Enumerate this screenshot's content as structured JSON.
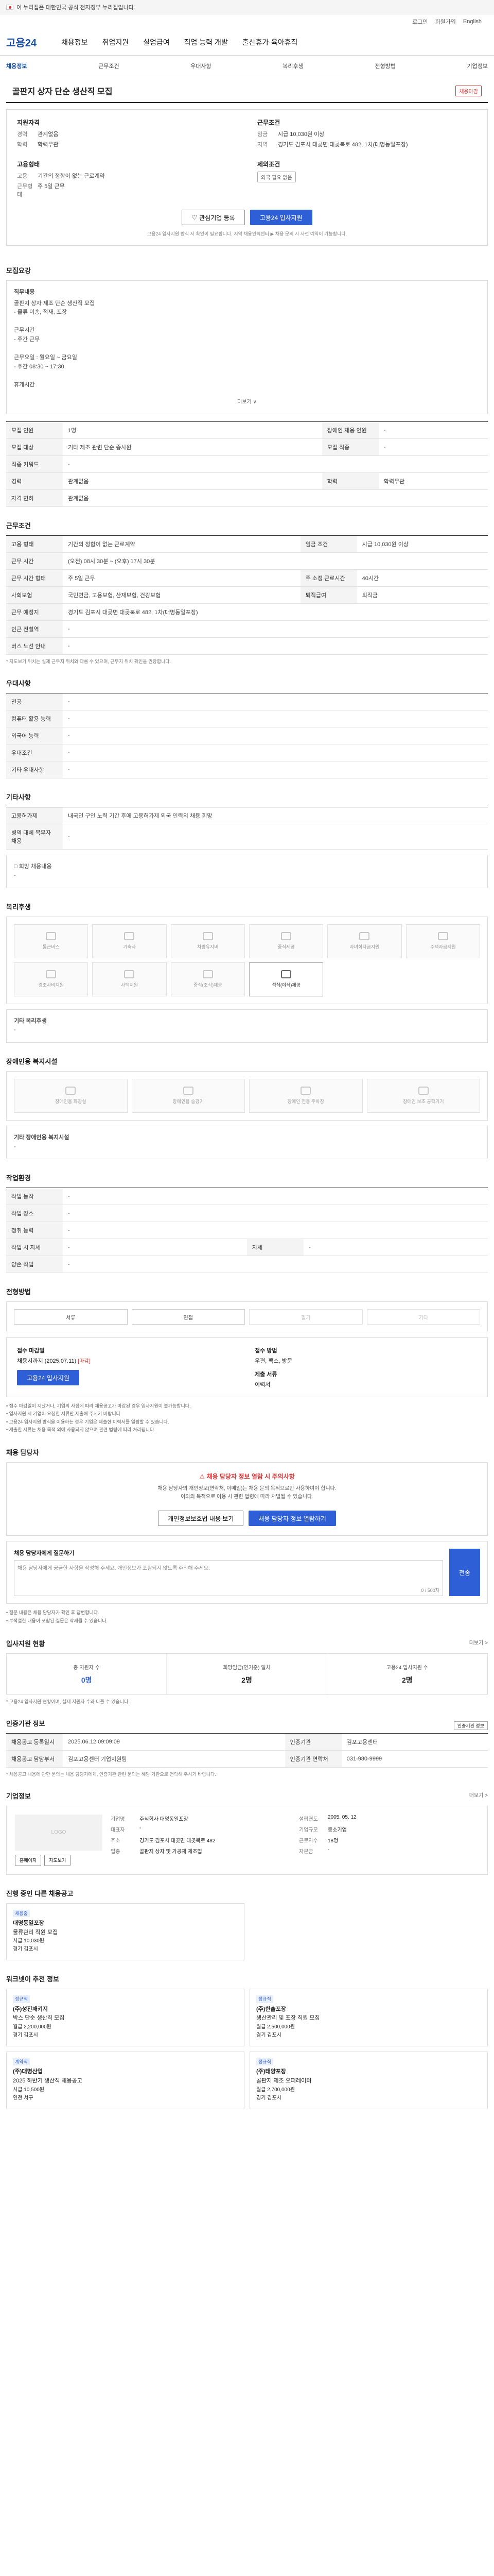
{
  "gov_banner": "이 누리집은 대한민국 공식 전자정부 누리집입니다.",
  "util": [
    "로그인",
    "회원가입",
    "English"
  ],
  "logo": "고용24",
  "gnb": [
    "채용정보",
    "취업지원",
    "실업급여",
    "직업 능력 개발",
    "출산휴가·육아휴직"
  ],
  "subnav": [
    "채용정보",
    "근무조건",
    "우대사항",
    "복리후생",
    "전형방법",
    "기업정보"
  ],
  "title": "골판지 상자 단순 생산직 모집",
  "status_badge": "채용마감",
  "summary": {
    "left_h1": "지원자격",
    "exp_k": "경력",
    "exp_v": "관계없음",
    "edu_k": "학력",
    "edu_v": "학력무관",
    "left_h2": "고용형태",
    "emp_k": "고용",
    "emp_v": "기간의 정함이 없는 근로계약",
    "type_k": "근무형태",
    "type_v": "주 5일 근무",
    "right_h1": "근무조건",
    "pay_k": "임금",
    "pay_v": "시급 10,030원 이상",
    "area_k": "지역",
    "area_v": "경기도 김포시 대곶면 대곶북로 482, 1차(대명동일포장)",
    "right_h2": "제외조건",
    "excl_v": "외국 필요 없음"
  },
  "buttons": {
    "interest": "관심기업 등록",
    "apply": "고용24 입사지원"
  },
  "summary_hint": "고용24 입사지원 방식 시 확인이 필요합니다. 지역 채용인력센터 ▶ 채용 문의 시 사전 예약이 가능합니다.",
  "section_job": {
    "title": "모집요강",
    "desc_title": "직무내용",
    "desc_lines": [
      "골판지 상자 제조 단순 생산직 모집",
      "- 물류 이송, 적재, 포장",
      "",
      "근무시간",
      "- 주간 근무",
      "",
      "근무요일 : 월요일 ~ 금요일",
      "- 주간 08:30 ~ 17:30",
      "",
      "휴게시간"
    ],
    "more": "더보기 ∨"
  },
  "table1": [
    [
      "모집 인원",
      "1명",
      "장애인 채용 인원",
      "-"
    ],
    [
      "모집 대상",
      "기타 제조 관련 단순 종사원",
      "모집 직종",
      "-"
    ],
    [
      "직종 키워드",
      "-",
      "",
      ""
    ],
    [
      "경력",
      "관계없음",
      "학력",
      "학력무관"
    ],
    [
      "자격 면허",
      "관계없음",
      "",
      ""
    ]
  ],
  "section_cond": {
    "title": "근무조건"
  },
  "table2": [
    [
      "고용 형태",
      "기간의 정함이 없는 근로계약",
      "임금 조건",
      "시급 10,030원 이상"
    ],
    [
      "근무 시간",
      "(오전) 08시 30분 ~ (오후) 17시 30분",
      "",
      ""
    ],
    [
      "근무 시간 형태",
      "주 5일 근무",
      "주 소정 근로시간",
      "40시간"
    ],
    [
      "사회보험",
      "국민연금, 고용보험, 산재보험, 건강보험",
      "퇴직급여",
      "퇴직금"
    ],
    [
      "근무 예정지",
      "경기도 김포시 대곶면 대곶북로 482, 1차(대명동일포장)",
      "",
      ""
    ],
    [
      "인근 전철역",
      "-",
      "",
      ""
    ],
    [
      "버스 노선 안내",
      "-",
      "",
      ""
    ]
  ],
  "cond_note": "* 지도보기 위치는 실제 근무지 위치와 다를 수 있으며, 근무지 위치 확인을 권장합니다.",
  "section_pref": {
    "title": "우대사항"
  },
  "table3": [
    [
      "전공",
      "-"
    ],
    [
      "컴퓨터 활용 능력",
      "-"
    ],
    [
      "외국어 능력",
      "-"
    ],
    [
      "우대조건",
      "-"
    ],
    [
      "기타 우대사항",
      "-"
    ]
  ],
  "section_add": {
    "title": "기타사항"
  },
  "table4": [
    [
      "고용허가제",
      "내국인 구인 노력 기간 후에 고용허가제 외국 인력의 채용 희망"
    ],
    [
      "병역 대체 복무자 채용",
      "-"
    ]
  ],
  "hope_title": "□ 희망 채용내용",
  "hope_value": "-",
  "section_welfare": {
    "title": "복리후생"
  },
  "welfare_icons": [
    {
      "label": "통근버스",
      "on": false
    },
    {
      "label": "기숙사",
      "on": false
    },
    {
      "label": "차량유지비",
      "on": false
    },
    {
      "label": "중식제공",
      "on": false
    },
    {
      "label": "자녀학자금지원",
      "on": false
    },
    {
      "label": "주택자금지원",
      "on": false
    },
    {
      "label": "경조사비지원",
      "on": false
    },
    {
      "label": "사택지원",
      "on": false
    },
    {
      "label": "중식(조식)제공",
      "on": false
    },
    {
      "label": "석식(야식)제공",
      "on": true
    }
  ],
  "welfare_etc_label": "기타 복리후생",
  "welfare_etc_value": "-",
  "section_disabled": {
    "title": "장애인용 복지시설"
  },
  "disabled_icons": [
    "장애인용 화장실",
    "장애인용 승강기",
    "장애인 전용 주차장",
    "장애인 보조 공학기기"
  ],
  "disabled_etc_label": "기타 장애인용 복지시설",
  "disabled_etc_value": "-",
  "section_env": {
    "title": "작업환경"
  },
  "table5": [
    [
      "작업 동작",
      "-",
      "",
      ""
    ],
    [
      "작업 장소",
      "-",
      "",
      ""
    ],
    [
      "청취 능력",
      "-",
      "",
      ""
    ],
    [
      "작업 시 자세",
      "-",
      "자세",
      "-"
    ],
    [
      "양손 작업",
      "-",
      "",
      ""
    ]
  ],
  "section_method": {
    "title": "전형방법"
  },
  "methods": [
    {
      "label": "서류",
      "on": true
    },
    {
      "label": "면접",
      "on": true
    },
    {
      "label": "필기",
      "on": false
    },
    {
      "label": "기타",
      "on": false
    }
  ],
  "apply": {
    "deadline_title": "접수 마감일",
    "deadline": "채용시까지 (2025.07.11)",
    "deadline_badge": "[마감]",
    "method_title": "접수 방법",
    "method": "우편, 팩스, 방문",
    "docs_title": "제출 서류",
    "docs": "이력서"
  },
  "apply_bullets": [
    "• 접수 마감일이 지났거나, 기업의 사정에 따라 채용공고가 마감된 경우 입사지원이 불가능합니다.",
    "• 입사지원 시 기업이 요청한 서류만 제출해 주시기 바랍니다.",
    "• 고용24 입사지원 방식을 이용하는 경우 기업은 제출한 이력서를 열람할 수 있습니다.",
    "• 제출한 서류는 채용 목적 외에 사용되지 않으며 관련 법령에 따라 처리됩니다."
  ],
  "section_contact": {
    "title": "채용 담당자"
  },
  "contact": {
    "warn": "⚠ 채용 담당자 정보 열람 시 주의사항",
    "desc1": "채용 담당자의 개인정보(연락처, 이메일)는 채용 문의 목적으로만 사용하여야 합니다.",
    "desc2": "이외의 목적으로 이용 시 관련 법령에 따라 처벌될 수 있습니다.",
    "btn_view": "개인정보보호법 내용 보기",
    "btn_agree": "채용 담당자 정보 열람하기"
  },
  "inquiry": {
    "label": "채용 담당자에게 질문하기",
    "placeholder": "채용 담당자에게 궁금한 사항을 작성해 주세요. 개인정보가 포함되지 않도록 주의해 주세요.",
    "count": "0 / 500자",
    "submit": "전송"
  },
  "inquiry_notes": [
    "• 질문 내용은 채용 담당자가 확인 후 답변합니다.",
    "• 부적절한 내용이 포함된 질문은 삭제될 수 있습니다."
  ],
  "section_stats": {
    "title": "입사지원 현황",
    "more": "더보기 >"
  },
  "stats": [
    {
      "label": "총 지원자 수",
      "value": "0명"
    },
    {
      "label": "희망임금(연기준) 일치",
      "value": "2명"
    },
    {
      "label": "고용24 입사지원 수",
      "value": "2명"
    }
  ],
  "stats_note": "* 고용24 입사지원 현황이며, 실제 지원자 수와 다를 수 있습니다.",
  "section_info": {
    "title": "인증기관 정보",
    "btn": "인증기관 정보"
  },
  "table6": [
    [
      "채용공고 등록일시",
      "2025.06.12 09:09:09",
      "인증기관",
      "김포고용센터"
    ],
    [
      "채용공고 담당부서",
      "김포고용센터 기업지원팀",
      "인증기관 연락처",
      "031-980-9999"
    ]
  ],
  "info_note": "* 채용공고 내용에 관한 문의는 채용 담당자에게, 인증기관 관련 문의는 해당 기관으로 연락해 주시기 바랍니다.",
  "section_company": {
    "title": "기업정보",
    "more": "더보기 >"
  },
  "company": {
    "logo": "LOGO",
    "ceo_k": "기업명",
    "ceo_v": "주식회사 대명동일포장",
    "rep_k": "대표자",
    "rep_v": "-",
    "addr_k": "주소",
    "addr_v": "경기도 김포시 대곶면 대곶북로 482",
    "biz_k": "업종",
    "biz_v": "골판지 상자 및 가공제 제조업",
    "found_k": "설립연도",
    "found_v": "2005. 05. 12",
    "size_k": "기업규모",
    "size_v": "중소기업",
    "emp_k": "근로자수",
    "emp_v": "18명",
    "cap_k": "자본금",
    "cap_v": "-",
    "btn_home": "홈페이지",
    "btn_map": "지도보기"
  },
  "section_other": {
    "title": "진행 중인 다른 채용공고"
  },
  "other_jobs": [
    {
      "comp": "대명동일포장",
      "title": "물류관리 직원 모집",
      "tag": "채용중",
      "pay": "시급 10,030원",
      "area": "경기 김포시"
    }
  ],
  "section_reco": {
    "title": "워크넷이 추천 정보"
  },
  "reco": [
    {
      "tag": "정규직",
      "comp": "(주)성진패키지",
      "title": "박스 단순 생산직 모집",
      "pay": "월급 2,200,000원",
      "area": "경기 김포시"
    },
    {
      "tag": "정규직",
      "comp": "(주)한솔포장",
      "title": "생산관리 및 포장 직원 모집",
      "pay": "월급 2,500,000원",
      "area": "경기 김포시"
    },
    {
      "tag": "계약직",
      "comp": "(주)대명산업",
      "title": "2025 하반기 생산직 채용공고",
      "pay": "시급 10,500원",
      "area": "인천 서구"
    },
    {
      "tag": "정규직",
      "comp": "(주)태양포장",
      "title": "골판지 제조 오퍼레이터",
      "pay": "월급 2,700,000원",
      "area": "경기 김포시"
    }
  ]
}
